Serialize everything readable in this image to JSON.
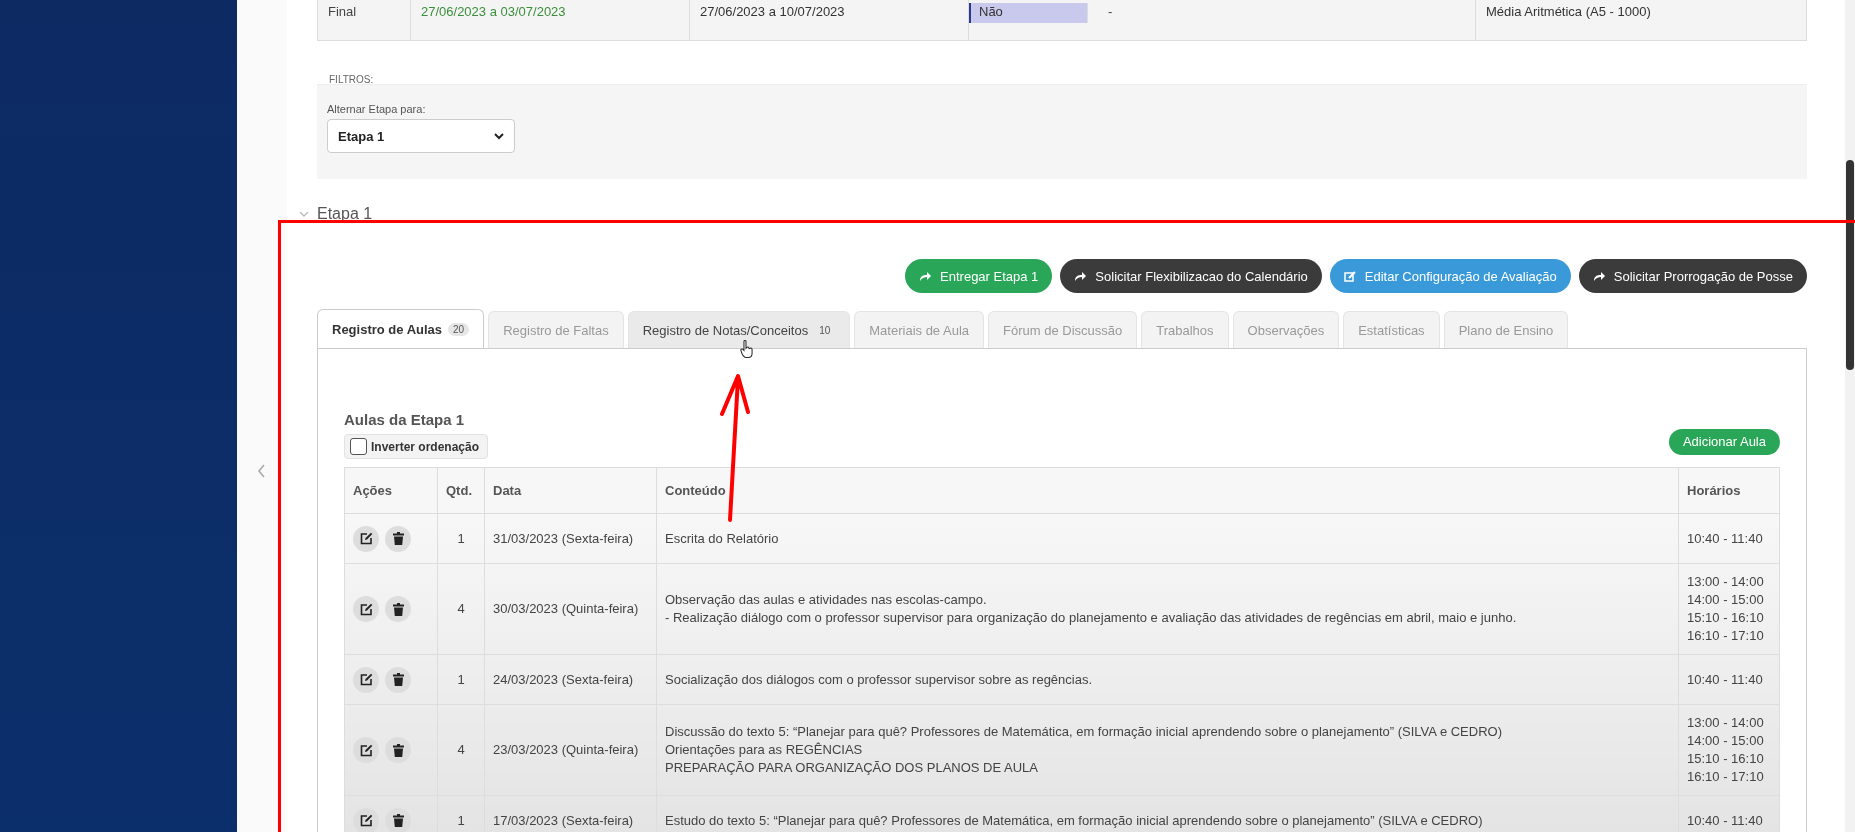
{
  "summary_row": {
    "cells": [
      "Final",
      "27/06/2023 a 03/07/2023",
      "27/06/2023 a 10/07/2023",
      "Não",
      "-",
      "Média Aritmética (A5 - 1000)"
    ]
  },
  "filters": {
    "title": "FILTROS:",
    "label": "Alternar Etapa para:",
    "value": "Etapa 1"
  },
  "section": {
    "title": "Etapa 1",
    "expanded": true
  },
  "action_buttons": [
    {
      "label": "Entregar Etapa 1",
      "kind": "success"
    },
    {
      "label": "Solicitar Flexibilizacao do Calendário",
      "kind": "dark"
    },
    {
      "label": "Editar Configuração de Avaliação",
      "kind": "primary"
    },
    {
      "label": "Solicitar Prorrogação de Posse",
      "kind": "dark"
    }
  ],
  "tabs": [
    {
      "label": "Registro de Aulas",
      "count": "20",
      "selected": true
    },
    {
      "label": "Registro de Faltas",
      "selected": false
    },
    {
      "label": "Registro de Notas/Conceitos",
      "count": "10",
      "selected": false
    },
    {
      "label": "Materiais de Aula",
      "selected": false
    },
    {
      "label": "Fórum de Discussão",
      "selected": false
    },
    {
      "label": "Trabalhos",
      "selected": false
    },
    {
      "label": "Observações",
      "selected": false
    },
    {
      "label": "Estatísticas",
      "selected": false
    },
    {
      "label": "Plano de Ensino",
      "selected": false
    }
  ],
  "panel": {
    "title": "Aulas da Etapa 1",
    "sort_checkbox": {
      "label": "Inverter ordenação",
      "checked": false
    },
    "add_button": "Adicionar Aula"
  },
  "table": {
    "columns": [
      "Ações",
      "Qtd.",
      "Data",
      "Conteúdo",
      "Horários"
    ],
    "rows": [
      {
        "qtd": "1",
        "date": "31/03/2023 (Sexta-feira)",
        "content": [
          "Escrita do Relatório"
        ],
        "times": [
          "10:40 - 11:40"
        ]
      },
      {
        "qtd": "4",
        "date": "30/03/2023 (Quinta-feira)",
        "content": [
          "Observação das aulas e atividades nas escolas-campo.",
          "- Realização diálogo com o professor supervisor para organização do planejamento e avaliação das atividades de regências em abril, maio e junho."
        ],
        "times": [
          "13:00 - 14:00",
          "14:00 - 15:00",
          "15:10 - 16:10",
          "16:10 - 17:10"
        ]
      },
      {
        "qtd": "1",
        "date": "24/03/2023 (Sexta-feira)",
        "content": [
          "Socialização dos diálogos com o professor supervisor sobre as regências."
        ],
        "times": [
          "10:40 - 11:40"
        ]
      },
      {
        "qtd": "4",
        "date": "23/03/2023 (Quinta-feira)",
        "content": [
          "Discussão do texto 5: “Planejar para quê? Professores de Matemática, em formação inicial aprendendo sobre o planejamento” (SILVA e CEDRO)",
          "Orientações para as REGÊNCIAS",
          "PREPARAÇÃO PARA ORGANIZAÇÃO DOS PLANOS DE AULA"
        ],
        "times": [
          "13:00 - 14:00",
          "14:00 - 15:00",
          "15:10 - 16:10",
          "16:10 - 17:10"
        ]
      },
      {
        "qtd": "1",
        "date": "17/03/2023 (Sexta-feira)",
        "content": [
          "Estudo do texto 5: “Planejar para quê? Professores de Matemática, em formação inicial aprendendo sobre o planejamento” (SILVA e CEDRO)"
        ],
        "times": [
          "10:40 - 11:40"
        ]
      }
    ]
  }
}
